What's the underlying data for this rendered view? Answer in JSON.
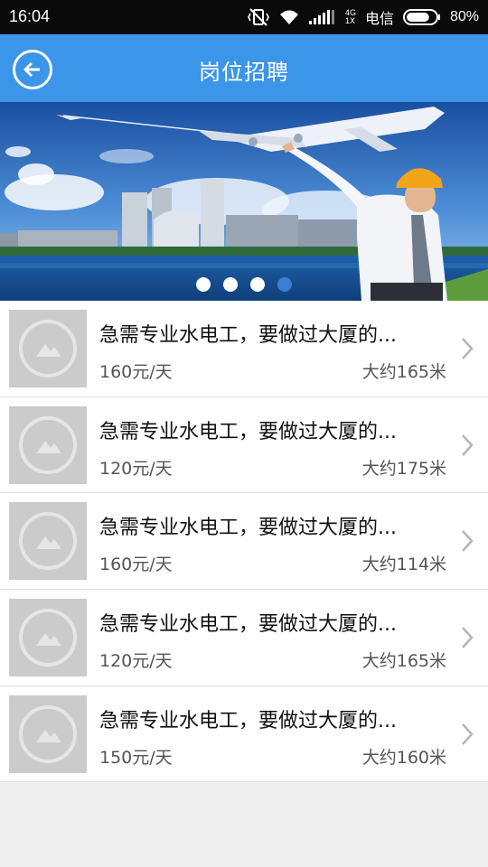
{
  "status_bar": {
    "time": "16:04",
    "network_top": "4G",
    "network_bottom": "1X",
    "carrier": "电信",
    "battery": "80%",
    "battery_level": 0.8
  },
  "app_bar": {
    "title": "岗位招聘",
    "back_icon": "back-arrow-icon"
  },
  "banner": {
    "slide_count": 4,
    "active_slide": 4
  },
  "jobs": [
    {
      "title": "急需专业水电工，要做过大厦的...",
      "salary": "160元/天",
      "distance": "大约165米"
    },
    {
      "title": "急需专业水电工，要做过大厦的...",
      "salary": "120元/天",
      "distance": "大约175米"
    },
    {
      "title": "急需专业水电工，要做过大厦的...",
      "salary": "160元/天",
      "distance": "大约114米"
    },
    {
      "title": "急需专业水电工，要做过大厦的...",
      "salary": "120元/天",
      "distance": "大约165米"
    },
    {
      "title": "急需专业水电工，要做过大厦的...",
      "salary": "150元/天",
      "distance": "大约160米"
    }
  ],
  "colors": {
    "app_bar": "#3b95e8",
    "active_dot": "#3b7fd4",
    "placeholder": "#cbcbcb"
  }
}
